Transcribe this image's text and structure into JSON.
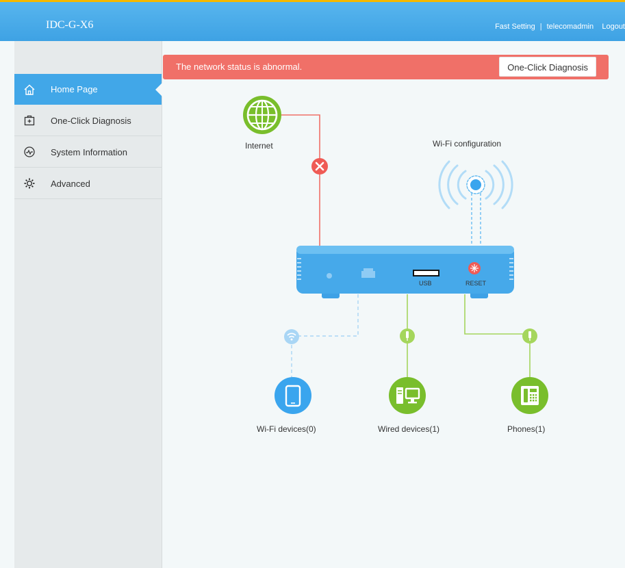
{
  "header": {
    "brand": "IDC-G-X6",
    "links": {
      "fast_setting": "Fast Setting",
      "separator": "|",
      "user": "telecomadmin",
      "logout": "Logout"
    }
  },
  "sidebar": {
    "items": [
      {
        "label": "Home Page",
        "icon": "home-icon",
        "active": true
      },
      {
        "label": "One-Click Diagnosis",
        "icon": "medical-kit-icon"
      },
      {
        "label": "System Information",
        "icon": "heartbeat-icon"
      },
      {
        "label": "Advanced",
        "icon": "gear-icon"
      }
    ]
  },
  "banner": {
    "message": "The network status is abnormal.",
    "button": "One-Click Diagnosis"
  },
  "topology": {
    "internet": "Internet",
    "wifi_config": "Wi-Fi configuration",
    "usb": "USB",
    "reset": "RESET",
    "wifi_devices": "Wi-Fi devices(0)",
    "wired_devices": "Wired devices(1)",
    "phones": "Phones(1)"
  },
  "colors": {
    "header": "#4aaee9",
    "accent_line": "#f5b800",
    "sidebar_active": "#41a7e8",
    "error": "#f07068",
    "ok_green": "#8ccc2e",
    "router": "#46a9ea"
  }
}
